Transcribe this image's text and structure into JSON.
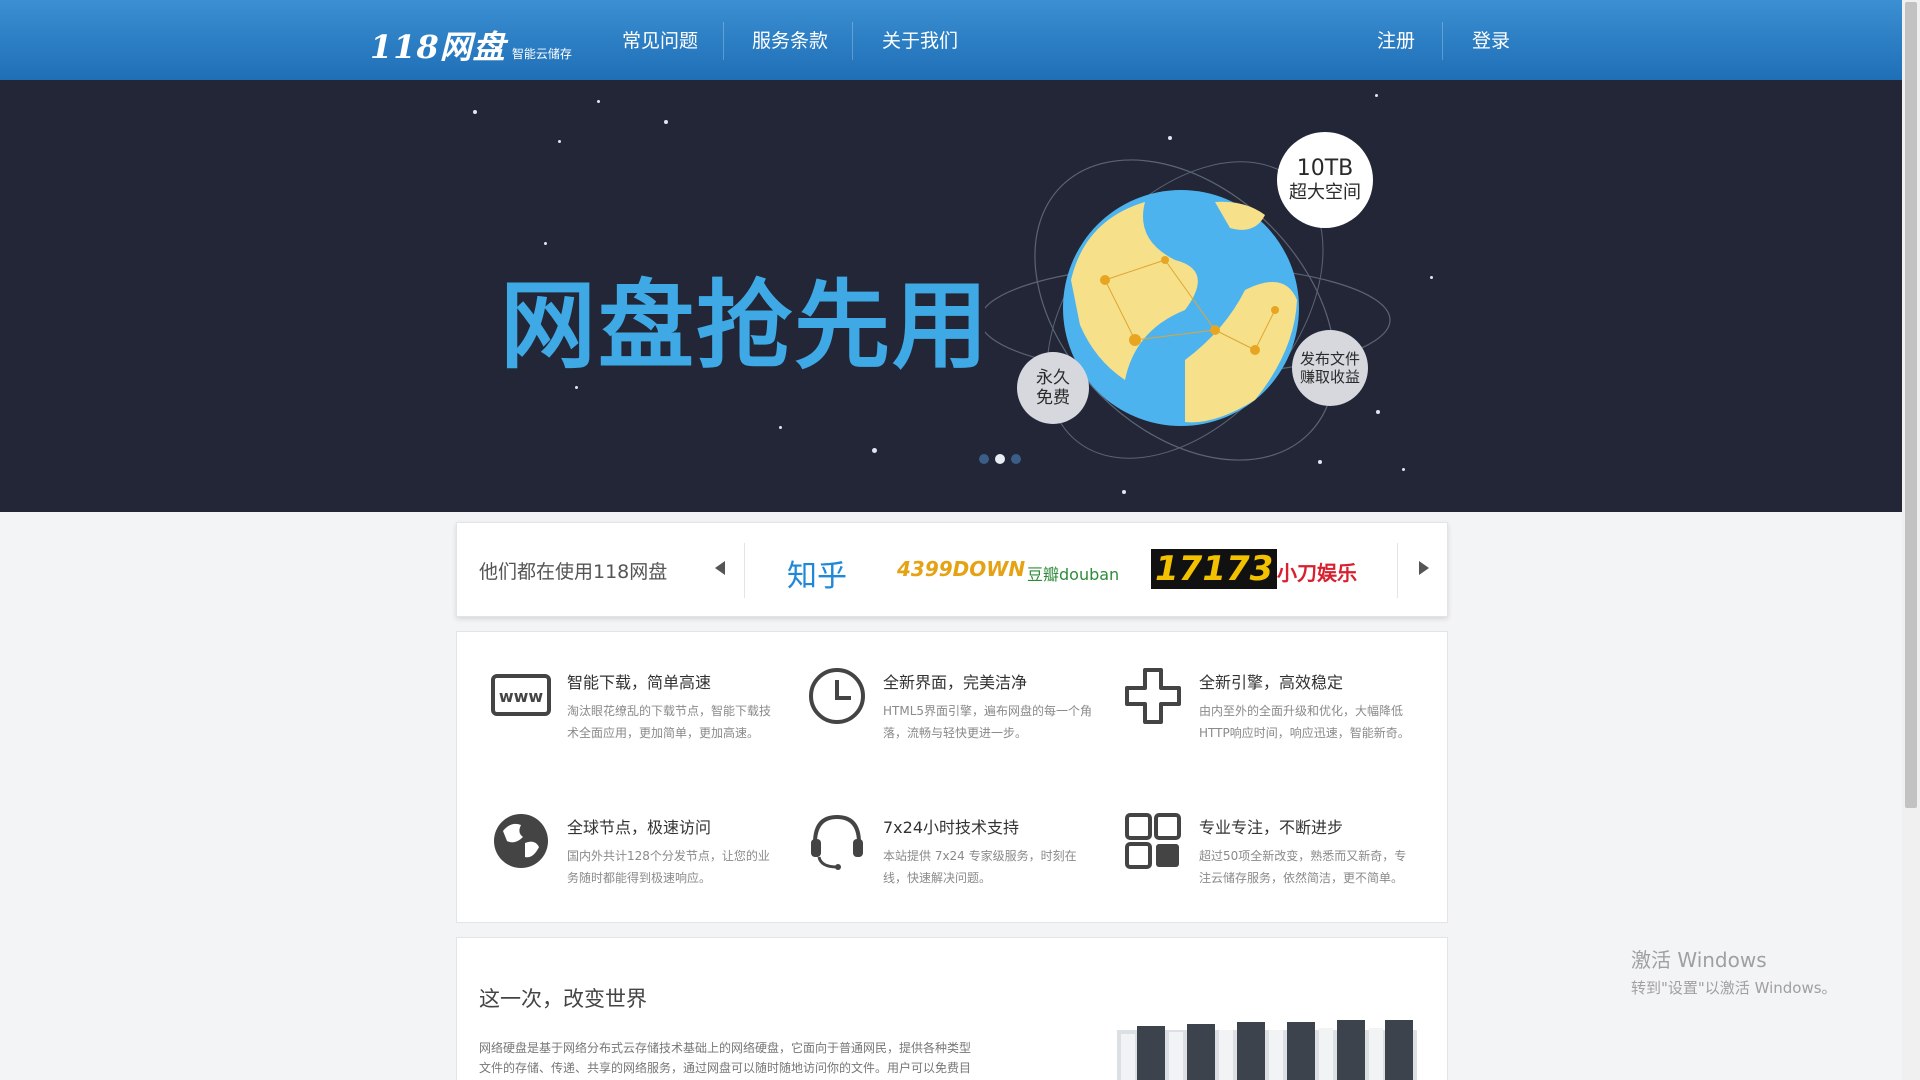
{
  "header": {
    "logo_main": "118网盘",
    "logo_sub": "智能云储存",
    "nav": [
      {
        "label": "常见问题"
      },
      {
        "label": "服务条款"
      },
      {
        "label": "关于我们"
      }
    ],
    "register": "注册",
    "login": "登录"
  },
  "hero": {
    "title": "网盘抢先用",
    "bubble_storage_line1": "10TB",
    "bubble_storage_line2": "超大空间",
    "bubble_free_line1": "永久",
    "bubble_free_line2": "免费",
    "bubble_earn_line1": "发布文件",
    "bubble_earn_line2": "赚取收益",
    "slides": 3,
    "active_slide": 1
  },
  "partners": {
    "label": "他们都在使用118网盘",
    "brands": [
      "知乎",
      "4399DOWN",
      "豆瓣douban",
      "17173",
      "小刀娱乐"
    ]
  },
  "features": [
    {
      "icon": "www-icon",
      "title": "智能下载，简单高速",
      "desc": "淘汰眼花缭乱的下载节点，智能下载技术全面应用，更加简单，更加高速。"
    },
    {
      "icon": "clock-icon",
      "title": "全新界面，完美洁净",
      "desc": "HTML5界面引擎，遍布网盘的每一个角落，流畅与轻快更进一步。"
    },
    {
      "icon": "plus-icon",
      "title": "全新引擎，高效稳定",
      "desc": "由内至外的全面升级和优化，大幅降低HTTP响应时间，响应迅速，智能新奇。"
    },
    {
      "icon": "globe-icon",
      "title": "全球节点，极速访问",
      "desc": "国内外共计128个分发节点，让您的业务随时都能得到极速响应。"
    },
    {
      "icon": "headset-icon",
      "title": "7x24小时技术支持",
      "desc": "本站提供 7x24 专家级服务，时刻在线，快速解决问题。"
    },
    {
      "icon": "grid-icon",
      "title": "专业专注，不断进步",
      "desc": "超过50项全新改变，熟悉而又新奇，专注云储存服务，依然简洁，更不简单。"
    }
  ],
  "intro": {
    "title": "这一次，改变世界",
    "text": "网络硬盘是基于网络分布式云存储技术基础上的网络硬盘，它面向于普通网民，提供各种类型文件的存储、传递、共享的网络服务，通过网盘可以随时随地访问你的文件。用户可以免费目"
  },
  "watermark": {
    "title": "激活 Windows",
    "subtitle": "转到\"设置\"以激活 Windows。"
  },
  "colors": {
    "header": "#2a7fc7",
    "hero_bg": "#232637",
    "hero_title": "#3ea9e5",
    "globe_ocean": "#4db3ef",
    "globe_land": "#f6e08a"
  }
}
